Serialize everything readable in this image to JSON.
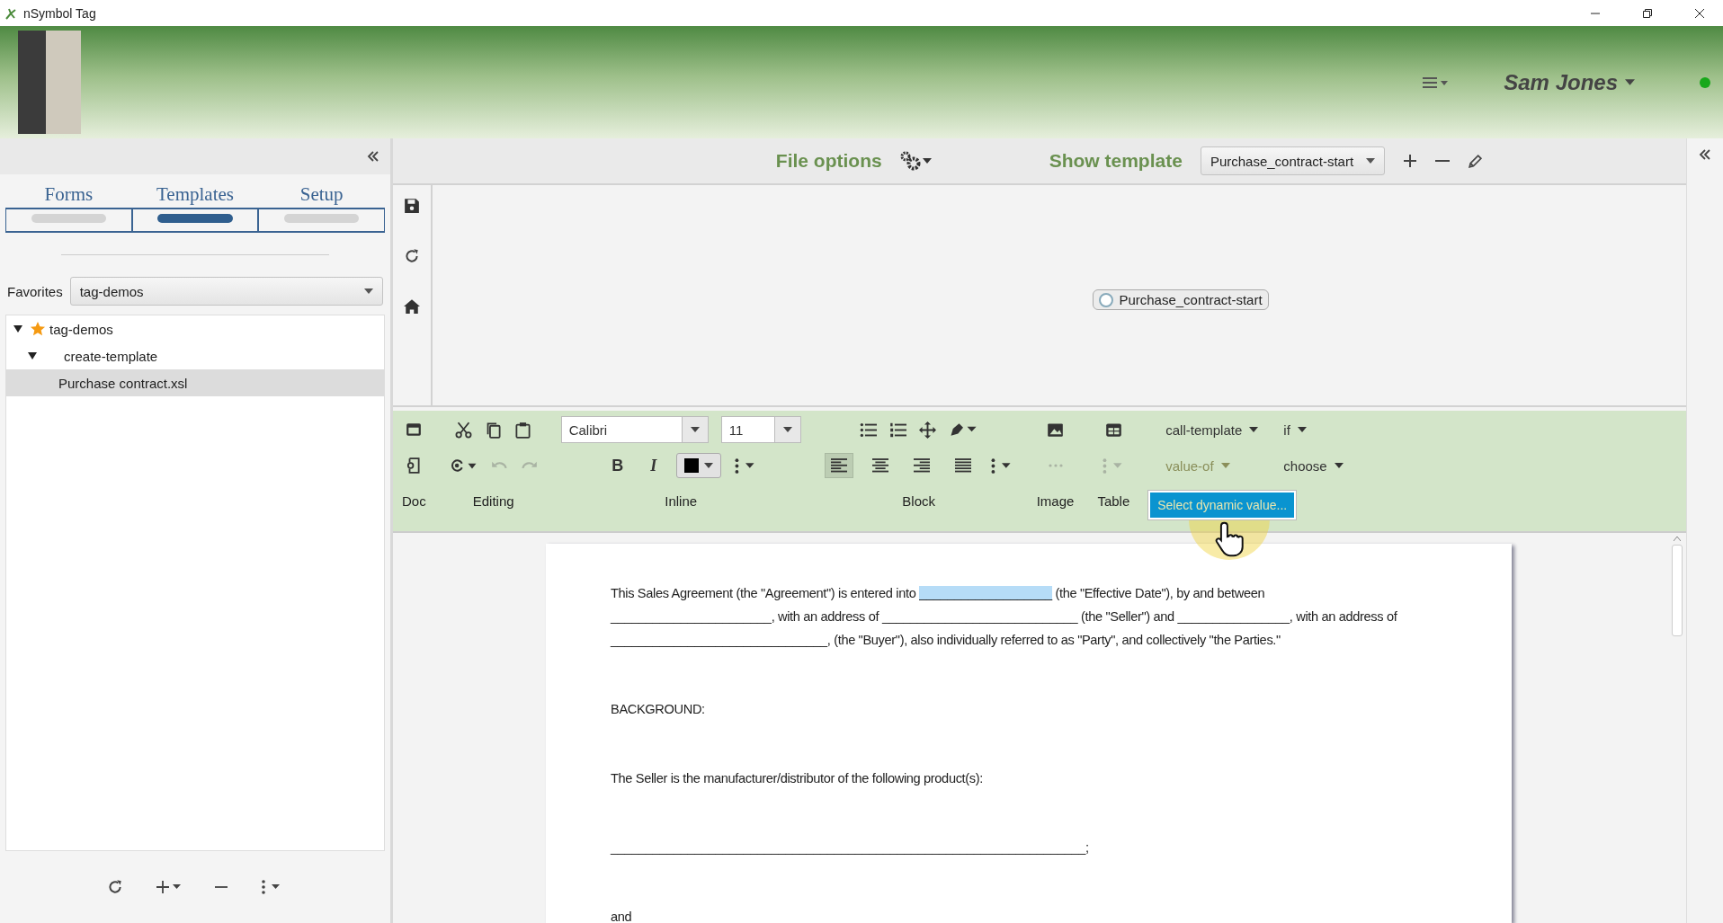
{
  "window": {
    "title": "nSymbol Tag"
  },
  "header": {
    "user": "Sam Jones",
    "online": true
  },
  "sidebar": {
    "tabs": [
      {
        "label": "Forms",
        "selected": false
      },
      {
        "label": "Templates",
        "selected": true
      },
      {
        "label": "Setup",
        "selected": false
      }
    ],
    "favorites": {
      "label": "Favorites",
      "value": "tag-demos"
    },
    "tree": [
      {
        "label": "tag-demos",
        "starred": true,
        "expanded": true,
        "selected": false,
        "children": [
          {
            "label": "create-template",
            "starred": false,
            "expanded": true,
            "selected": false,
            "children": [
              {
                "label": "Purchase contract.xsl",
                "starred": false,
                "selected": true
              }
            ]
          }
        ]
      }
    ]
  },
  "file_bar": {
    "file_options": "File options",
    "show_template": "Show template",
    "template": "Purchase_contract-start"
  },
  "preview": {
    "node": "Purchase_contract-start"
  },
  "toolbar": {
    "font": "Calibri",
    "size": "11",
    "bold": "B",
    "italic": "I",
    "undo": {
      "disabled": true
    },
    "redo": {
      "disabled": true
    },
    "alignments": [
      {
        "kind": "left",
        "selected": true
      },
      {
        "kind": "center",
        "selected": false
      },
      {
        "kind": "right",
        "selected": false
      },
      {
        "kind": "justify",
        "selected": false
      }
    ],
    "image_more": {
      "disabled": true
    },
    "table_more": {
      "disabled": true
    },
    "groups": [
      "Doc",
      "Editing",
      "Inline",
      "Block",
      "Image",
      "Table"
    ],
    "xsl_buttons": [
      {
        "label": "call-template",
        "open": false
      },
      {
        "label": "if",
        "open": false
      },
      {
        "label": "value-of",
        "open": true,
        "menu": [
          "Select dynamic value..."
        ]
      },
      {
        "label": "choose",
        "open": false
      }
    ]
  },
  "document": {
    "intro": {
      "before": "This Sales Agreement (the \"Agreement\") is entered into ",
      "highlighted": "___________________",
      "after": " (the \"Effective Date\"), by and between _______________________, with an address of ____________________________ (the \"Seller\") and ________________, with an address of _______________________________, (the \"Buyer\"), also individually referred to as \"Party\", and collectively \"the Parties.\""
    },
    "paragraphs": [
      "BACKGROUND:",
      "The Seller is the manufacturer/distributor of the following product(s):",
      "____________________________________________________________________;",
      "and"
    ]
  }
}
